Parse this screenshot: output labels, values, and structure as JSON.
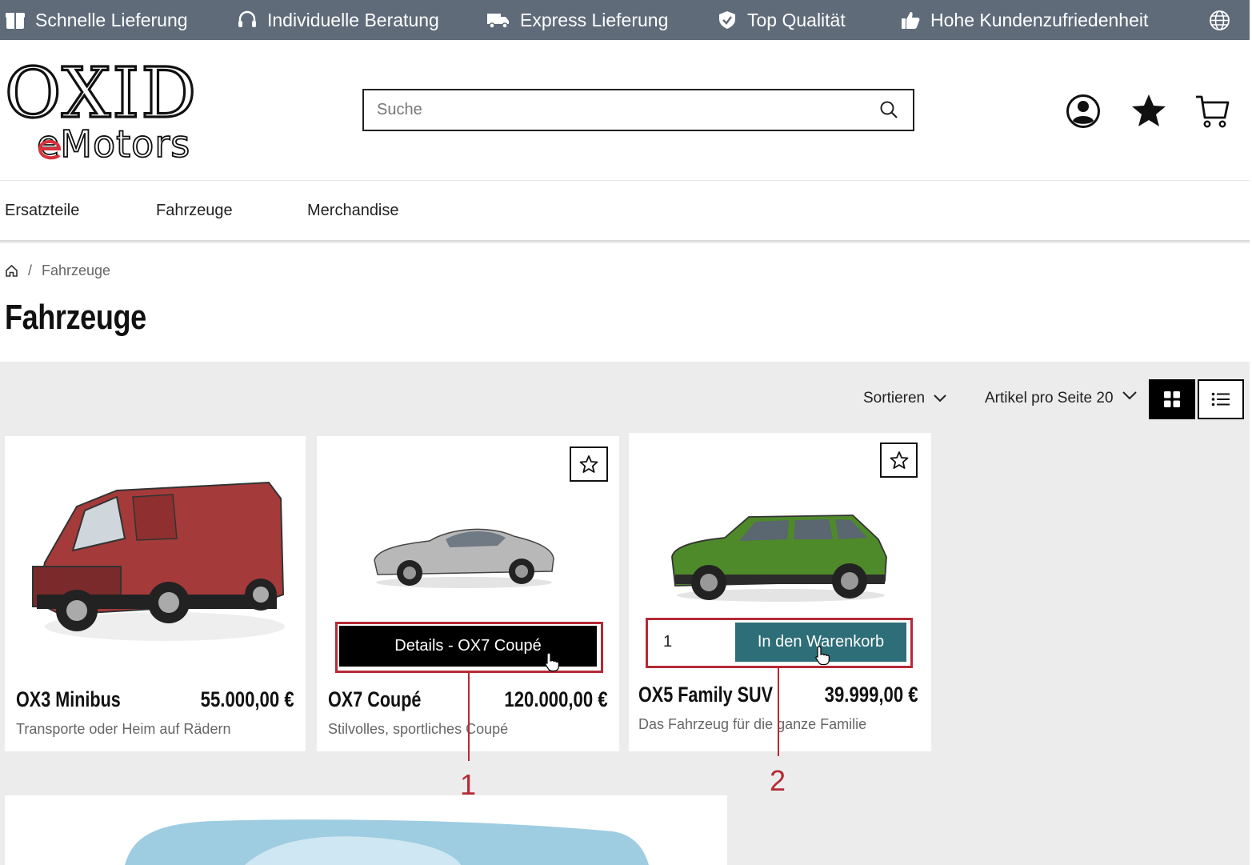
{
  "topbar": {
    "items": [
      {
        "label": "Schnelle Lieferung",
        "icon": "gift-box-icon"
      },
      {
        "label": "Individuelle Beratung",
        "icon": "headset-icon"
      },
      {
        "label": "Express Lieferung",
        "icon": "delivery-truck-icon"
      },
      {
        "label": "Top Qualität",
        "icon": "shield-check-icon"
      },
      {
        "label": "Hohe Kundenzufriedenheit",
        "icon": "thumbs-up-icon"
      }
    ],
    "language_icon": "globe-icon"
  },
  "header": {
    "logo_line1": "OXID",
    "logo_line2": "eMotors",
    "search_placeholder": "Suche",
    "icons": [
      "account-icon",
      "wishlist-star-icon",
      "cart-icon"
    ]
  },
  "nav": {
    "items": [
      "Ersatzteile",
      "Fahrzeuge",
      "Merchandise"
    ]
  },
  "breadcrumb": {
    "separator": "/",
    "current": "Fahrzeuge"
  },
  "page": {
    "title": "Fahrzeuge"
  },
  "toolbar": {
    "sort_label": "Sortieren",
    "per_page_label": "Artikel pro Seite 20"
  },
  "products": [
    {
      "name": "OX3 Minibus",
      "price": "55.000,00 €",
      "description": "Transporte oder Heim auf Rädern",
      "color": "#a53a3a"
    },
    {
      "name": "OX7 Coupé",
      "price": "120.000,00 €",
      "description": "Stilvolles, sportliches Coupé",
      "color": "#b8b8b8",
      "details_label": "Details - OX7 Coupé"
    },
    {
      "name": "OX5 Family SUV",
      "price": "39.999,00 €",
      "description": "Das Fahrzeug für die ganze Familie",
      "color": "#4e8a2a",
      "qty_value": "1",
      "cart_label": "In den Warenkorb"
    }
  ],
  "callouts": [
    "1",
    "2"
  ],
  "colors": {
    "topbar": "#5f6b79",
    "cart_button": "#2e6e78",
    "callout": "#b52a35",
    "logo_accent": "#d8323c"
  }
}
